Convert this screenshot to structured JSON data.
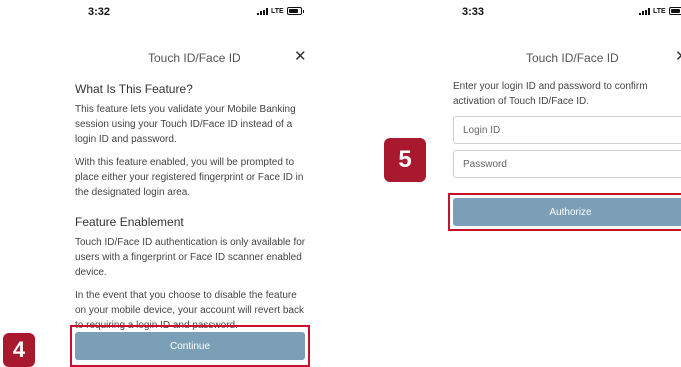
{
  "left_screen": {
    "status": {
      "time": "3:32",
      "network": "LTE"
    },
    "nav_title": "Touch ID/Face ID",
    "close_glyph": "✕",
    "section1_heading": "What Is This Feature?",
    "section1_p1": "This feature lets you validate your Mobile Banking session using your Touch ID/Face ID instead of a login ID and password.",
    "section1_p2": "With this feature enabled, you will be prompted to place either your registered fingerprint or Face ID in the designated login area.",
    "section2_heading": "Feature Enablement",
    "section2_p1": "Touch ID/Face ID authentication is only available for users with a fingerprint or Face ID scanner enabled device.",
    "section2_p2": "In the event that you choose to disable the feature on your mobile device, your account will revert back to requiring a login ID and password.",
    "continue_label": "Continue"
  },
  "right_screen": {
    "status": {
      "time": "3:33",
      "network": "LTE"
    },
    "nav_title": "Touch ID/Face ID",
    "close_glyph": "✕",
    "instruction": "Enter your login ID and password to confirm activation of Touch ID/Face ID.",
    "login_placeholder": "Login ID",
    "password_placeholder": "Password",
    "authorize_label": "Authorize"
  },
  "step_badges": {
    "left": "4",
    "right": "5"
  },
  "colors": {
    "button": "#7a9fb6",
    "highlight": "#c8102e",
    "badge": "#a8192e"
  }
}
